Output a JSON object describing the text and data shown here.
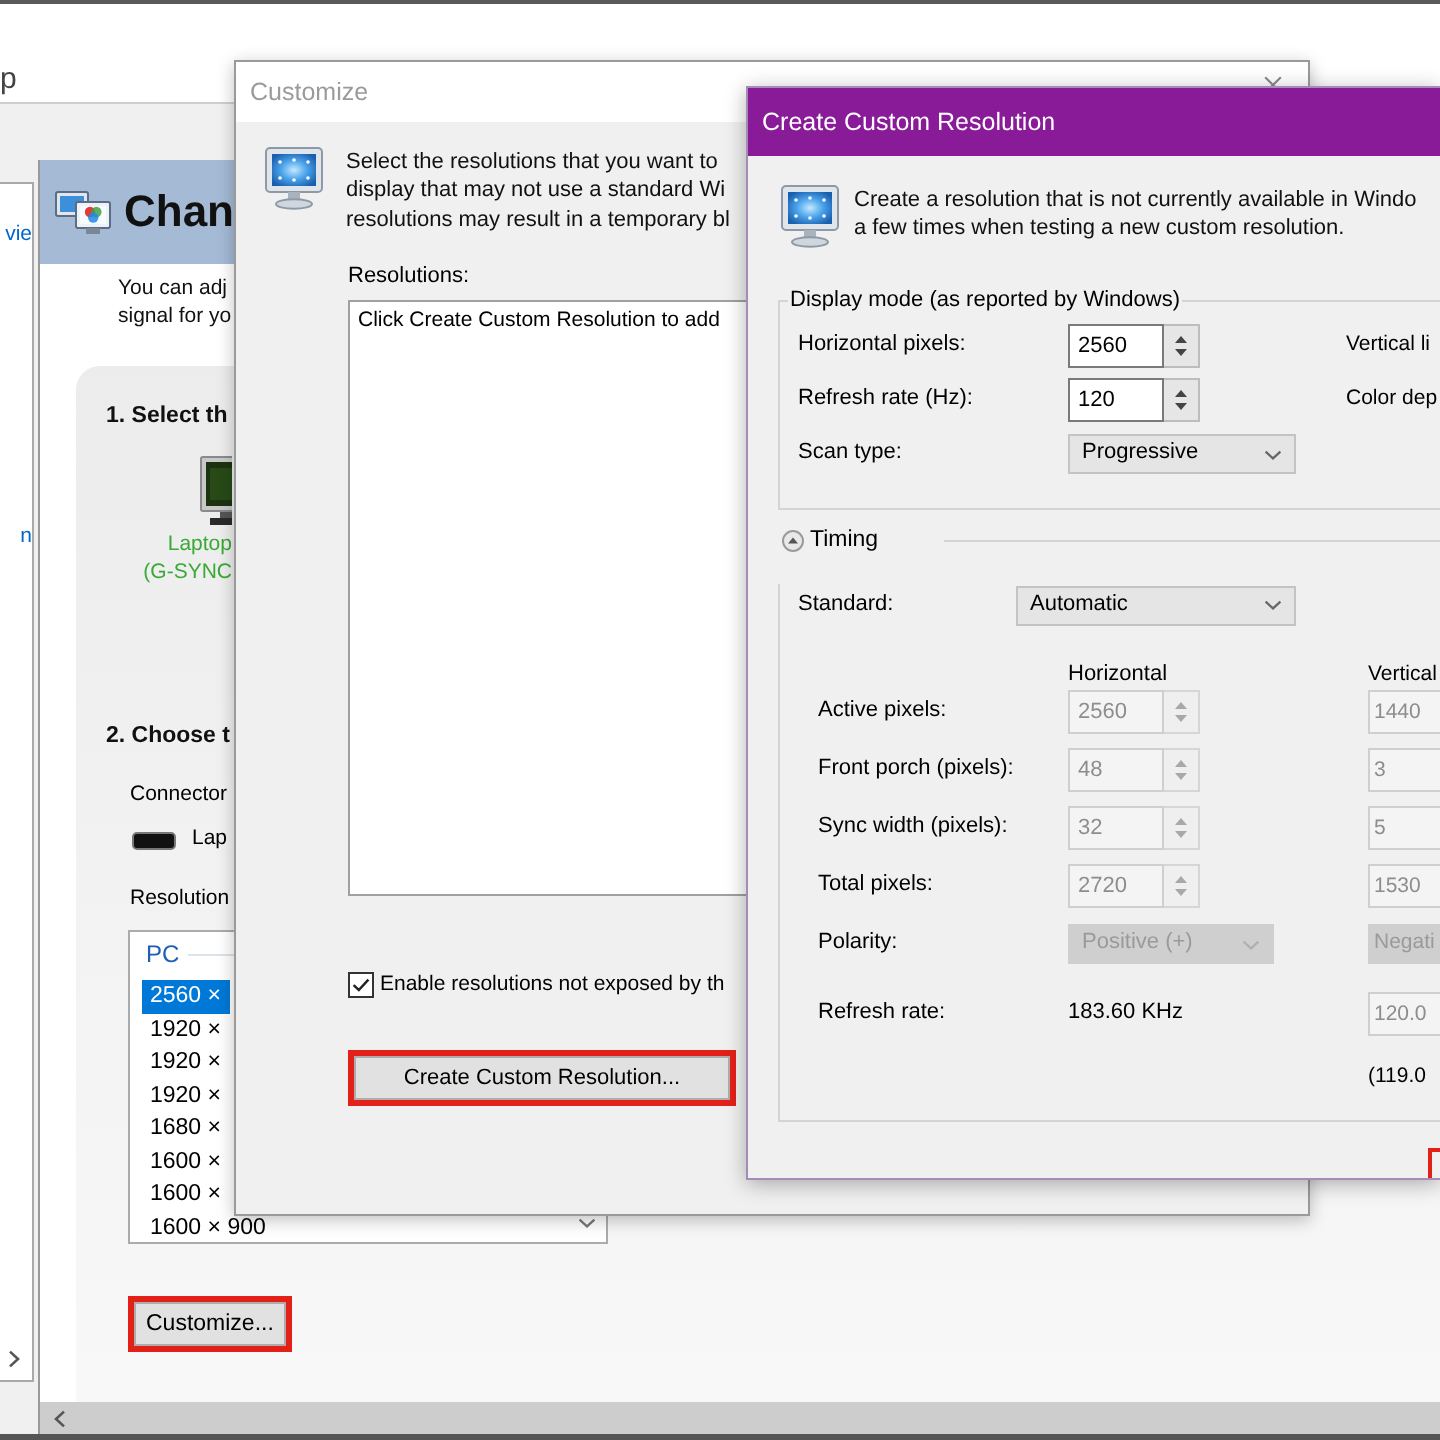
{
  "main_window": {
    "title": "p",
    "nav": {
      "items": [
        {
          "label": "vie"
        },
        {
          "label": "n"
        }
      ]
    },
    "header": {
      "title": "Chan"
    },
    "intro_lines": [
      "You can adj",
      "signal for yo"
    ],
    "section_1": {
      "heading": "1. Select th",
      "display": {
        "name_lines": [
          "Laptop",
          "(G-SYNC"
        ]
      }
    },
    "section_2": {
      "heading": "2. Choose t",
      "connector_label": "Connector",
      "connector_value": "Lap",
      "resolution_label": "Resolution",
      "resolution_list": {
        "group": "PC",
        "items": [
          {
            "label": "2560 ×",
            "selected": true
          },
          {
            "label": "1920 ×",
            "selected": false
          },
          {
            "label": "1920 ×",
            "selected": false
          },
          {
            "label": "1920 ×",
            "selected": false
          },
          {
            "label": "1680 ×",
            "selected": false
          },
          {
            "label": "1600 ×",
            "selected": false
          },
          {
            "label": "1600 ×",
            "selected": false
          },
          {
            "label": "1600 × 900",
            "selected": false
          }
        ]
      }
    },
    "customize_button": {
      "label": "Customize...",
      "highlighted": true
    }
  },
  "customize_dialog": {
    "title": "Customize",
    "description_lines": [
      "Select the resolutions that you want to",
      "display that may not use a standard Wi",
      "resolutions may result in a temporary bl"
    ],
    "resolutions_label": "Resolutions:",
    "resolutions_hint": "Click Create Custom Resolution to add",
    "enable_option": {
      "label": "Enable resolutions not exposed by th",
      "checked": true
    },
    "create_button": {
      "label": "Create Custom Resolution...",
      "highlighted": true
    }
  },
  "create_dialog": {
    "title": "Create Custom Resolution",
    "description_lines": [
      "Create a resolution that is not currently available in Windo",
      "a few times when testing a new custom resolution."
    ],
    "display_mode": {
      "title": "Display mode (as reported by Windows)",
      "rows": [
        {
          "kind": "spin",
          "label": "Horizontal pixels:",
          "value": "2560",
          "side_label": "Vertical li",
          "disabled": false
        },
        {
          "kind": "spin",
          "label": "Refresh rate (Hz):",
          "value": "120",
          "side_label": "Color dep",
          "disabled": false
        },
        {
          "kind": "select",
          "label": "Scan type:",
          "value": "Progressive",
          "disabled": false
        }
      ]
    },
    "timing": {
      "title": "Timing",
      "expanded": true,
      "standard": {
        "label": "Standard:",
        "value": "Automatic"
      },
      "columns": [
        "Horizontal",
        "Vertical"
      ],
      "rows": [
        {
          "kind": "spin",
          "label": "Active pixels:",
          "horizontal": "2560",
          "vertical": "1440",
          "disabled": true
        },
        {
          "kind": "spin",
          "label": "Front porch (pixels):",
          "horizontal": "48",
          "vertical": "3",
          "disabled": true
        },
        {
          "kind": "spin",
          "label": "Sync width (pixels):",
          "horizontal": "32",
          "vertical": "5",
          "disabled": true
        },
        {
          "kind": "spin",
          "label": "Total pixels:",
          "horizontal": "2720",
          "vertical": "1530",
          "disabled": true
        },
        {
          "kind": "select",
          "label": "Polarity:",
          "horizontal": "Positive (+)",
          "vertical": "Negati",
          "disabled": true
        },
        {
          "kind": "rate",
          "label": "Refresh rate:",
          "horizontal": "183.60 KHz",
          "vertical": "120.0",
          "disabled": true
        }
      ],
      "note": "(119.0"
    },
    "footer_button": {
      "highlighted": true
    }
  }
}
